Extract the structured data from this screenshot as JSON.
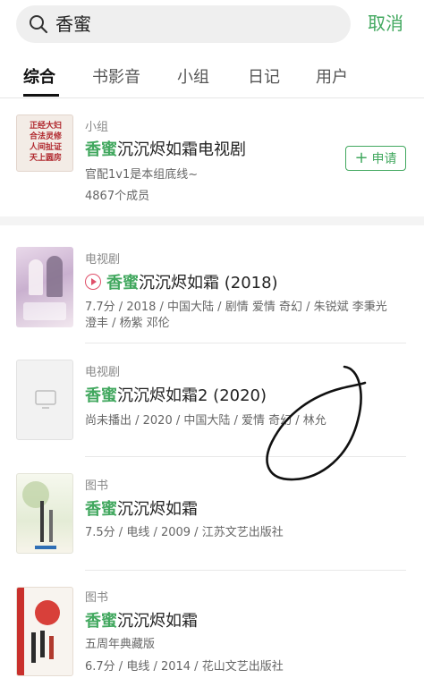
{
  "search": {
    "query": "香蜜",
    "cancel_label": "取消"
  },
  "tabs": [
    {
      "label": "综合",
      "active": true
    },
    {
      "label": "书影音",
      "active": false
    },
    {
      "label": "小组",
      "active": false
    },
    {
      "label": "日记",
      "active": false
    },
    {
      "label": "用户",
      "active": false
    }
  ],
  "group_result": {
    "type": "小组",
    "title_highlight": "香蜜",
    "title_rest": "沉沉烬如霜电视剧",
    "desc": "官配1v1是本组底线~",
    "members": "4867个成员",
    "apply_label": "申请",
    "thumb_text": [
      "正经大妇",
      "合法灵修",
      "人间扯证",
      "天上圆房"
    ]
  },
  "results": [
    {
      "type": "电视剧",
      "title_highlight": "香蜜",
      "title_rest": "沉沉烬如霜 (2018)",
      "line1": "7.7分 / 2018 / 中国大陆 / 剧情 爱情 奇幻 / 朱锐斌 李秉光",
      "line2": "澄丰 / 杨紫 邓伦",
      "playable": true
    },
    {
      "type": "电视剧",
      "title_highlight": "香蜜",
      "title_rest": "沉沉烬如霜2 (2020)",
      "line1": "尚未播出 / 2020 / 中国大陆 / 爱情 奇幻 / 林允"
    },
    {
      "type": "图书",
      "title_highlight": "香蜜",
      "title_rest": "沉沉烬如霜",
      "line1": "7.5分 / 电线 / 2009 / 江苏文艺出版社"
    },
    {
      "type": "图书",
      "title_highlight": "香蜜",
      "title_rest": "沉沉烬如霜",
      "line0": "五周年典藏版",
      "line1": "6.7分 / 电线 / 2014 / 花山文艺出版社"
    }
  ],
  "colors": {
    "accent": "#42a85f",
    "play": "#e0506a"
  }
}
